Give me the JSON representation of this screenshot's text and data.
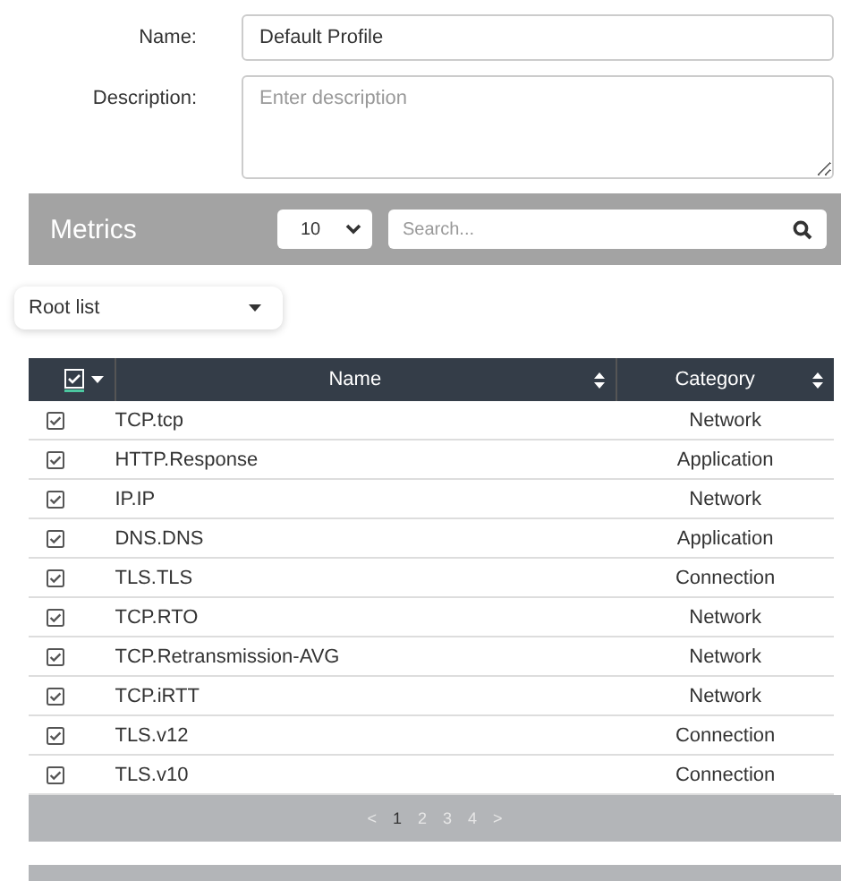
{
  "form": {
    "name_label": "Name:",
    "name_value": "Default Profile",
    "description_label": "Description:",
    "description_placeholder": "Enter description"
  },
  "metrics": {
    "title": "Metrics",
    "page_size": "10",
    "search_placeholder": "Search..."
  },
  "root_dropdown": "Root list",
  "table": {
    "columns": [
      "Name",
      "Category"
    ],
    "select_all_checked": true,
    "rows": [
      {
        "name": "TCP.tcp",
        "category": "Network",
        "checked": true
      },
      {
        "name": "HTTP.Response",
        "category": "Application",
        "checked": true
      },
      {
        "name": "IP.IP",
        "category": "Network",
        "checked": true
      },
      {
        "name": "DNS.DNS",
        "category": "Application",
        "checked": true
      },
      {
        "name": "TLS.TLS",
        "category": "Connection",
        "checked": true
      },
      {
        "name": "TCP.RTO",
        "category": "Network",
        "checked": true
      },
      {
        "name": "TCP.Retransmission-AVG",
        "category": "Network",
        "checked": true
      },
      {
        "name": "TCP.iRTT",
        "category": "Network",
        "checked": true
      },
      {
        "name": "TLS.v12",
        "category": "Connection",
        "checked": true
      },
      {
        "name": "TLS.v10",
        "category": "Connection",
        "checked": true
      }
    ]
  },
  "pagination": {
    "prev": "<",
    "next": ">",
    "pages": [
      {
        "label": "1",
        "selected": true
      },
      {
        "label": "2",
        "selected": false
      },
      {
        "label": "3",
        "selected": false
      },
      {
        "label": "4",
        "selected": false
      }
    ]
  }
}
